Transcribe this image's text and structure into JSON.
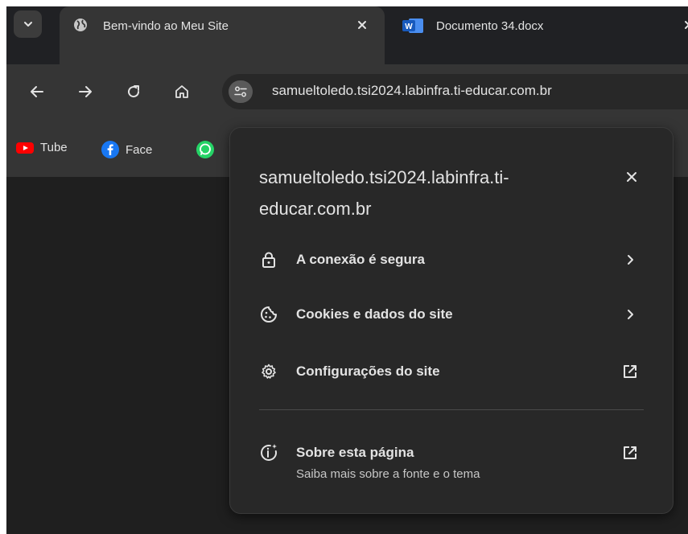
{
  "tabs": [
    {
      "title": "Bem-vindo ao Meu Site",
      "icon": "globe-icon",
      "active": true
    },
    {
      "title": "Documento 34.docx",
      "icon": "word-icon",
      "active": false
    }
  ],
  "toolbar": {
    "url": "samueltoledo.tsi2024.labinfra.ti-educar.com.br"
  },
  "bookmarks": [
    {
      "label": "Tube",
      "icon": "youtube-icon"
    },
    {
      "label": "Face",
      "icon": "facebook-icon"
    },
    {
      "label": "",
      "icon": "whatsapp-icon"
    }
  ],
  "popup": {
    "title": "samueltoledo.tsi2024.labinfra.ti-educar.com.br",
    "items": [
      {
        "label": "A conexão é segura",
        "icon": "lock-icon",
        "trail": "chevron-right-icon"
      },
      {
        "label": "Cookies e dados do site",
        "icon": "cookie-icon",
        "trail": "chevron-right-icon"
      },
      {
        "label": "Configurações do site",
        "icon": "gear-icon",
        "trail": "open-external-icon"
      }
    ],
    "about": {
      "label": "Sobre esta página",
      "sub": "Saiba mais sobre a fonte e o tema",
      "icon": "info-sparkle-icon",
      "trail": "open-external-icon"
    }
  },
  "colors": {
    "background": "#1f1f1f",
    "toolbar": "#353535",
    "popup": "#282828",
    "text": "#e3e3e3",
    "youtube_red": "#ff0000",
    "facebook_blue": "#1877f2",
    "whatsapp_green": "#25d366",
    "word_blue": "#185abd"
  }
}
